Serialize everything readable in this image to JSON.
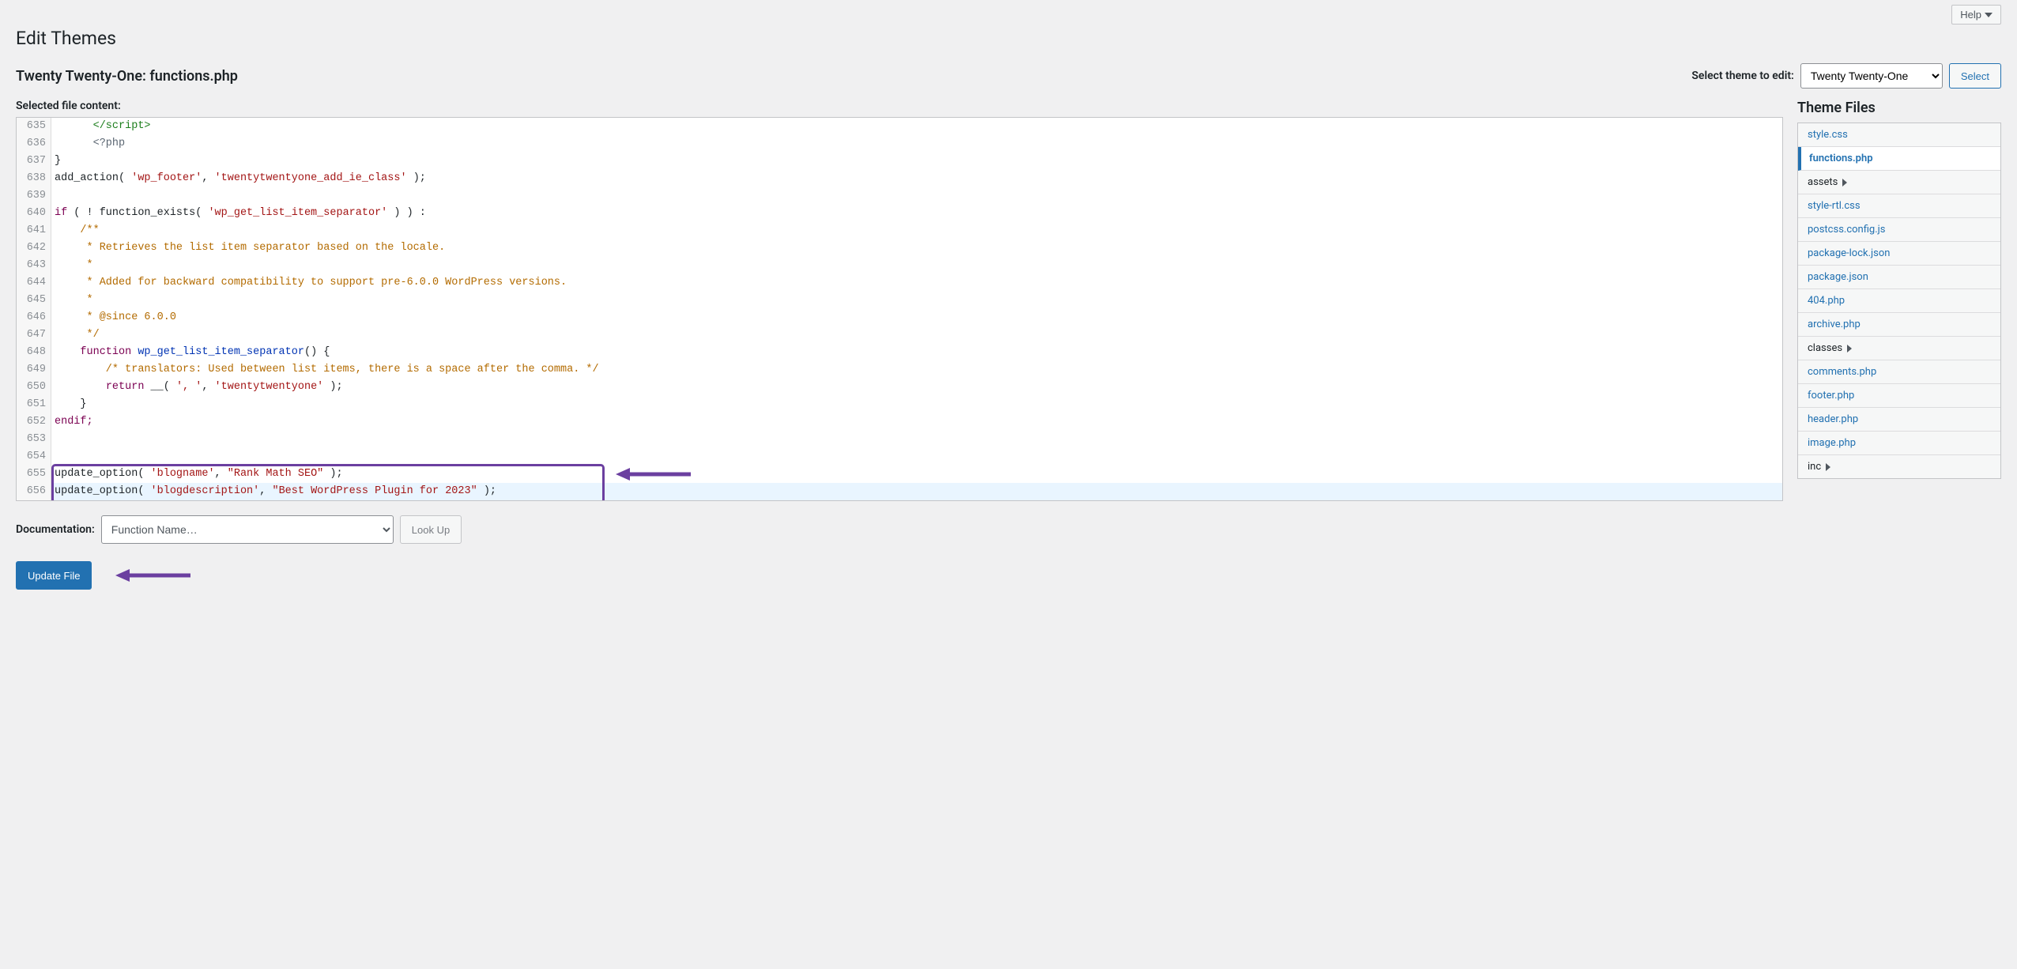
{
  "header": {
    "help": "Help",
    "page_title": "Edit Themes",
    "file_title": "Twenty Twenty-One: functions.php",
    "select_theme_label": "Select theme to edit:",
    "selected_theme": "Twenty Twenty-One",
    "select_button": "Select"
  },
  "editor": {
    "selected_file_label": "Selected file content:",
    "lines": [
      {
        "n": 635,
        "raw": "      </script>",
        "cls": "tag"
      },
      {
        "n": 636,
        "raw": "      <?php",
        "cls": "phpopen"
      },
      {
        "n": 637,
        "raw": "}",
        "cls": ""
      },
      {
        "n": 638,
        "raw": "add_action( 'wp_footer', 'twentytwentyone_add_ie_class' );",
        "cls": "call"
      },
      {
        "n": 639,
        "raw": "",
        "cls": ""
      },
      {
        "n": 640,
        "raw": "if ( ! function_exists( 'wp_get_list_item_separator' ) ) :",
        "cls": "if"
      },
      {
        "n": 641,
        "raw": "    /**",
        "cls": "cm"
      },
      {
        "n": 642,
        "raw": "     * Retrieves the list item separator based on the locale.",
        "cls": "cm"
      },
      {
        "n": 643,
        "raw": "     *",
        "cls": "cm"
      },
      {
        "n": 644,
        "raw": "     * Added for backward compatibility to support pre-6.0.0 WordPress versions.",
        "cls": "cm"
      },
      {
        "n": 645,
        "raw": "     *",
        "cls": "cm"
      },
      {
        "n": 646,
        "raw": "     * @since 6.0.0",
        "cls": "cm"
      },
      {
        "n": 647,
        "raw": "     */",
        "cls": "cm"
      },
      {
        "n": 648,
        "raw": "    function wp_get_list_item_separator() {",
        "cls": "func"
      },
      {
        "n": 649,
        "raw": "        /* translators: Used between list items, there is a space after the comma. */",
        "cls": "cm"
      },
      {
        "n": 650,
        "raw": "        return __( ', ', 'twentytwentyone' );",
        "cls": "ret"
      },
      {
        "n": 651,
        "raw": "    }",
        "cls": ""
      },
      {
        "n": 652,
        "raw": "endif;",
        "cls": "kw"
      },
      {
        "n": 653,
        "raw": "",
        "cls": ""
      },
      {
        "n": 654,
        "raw": "",
        "cls": ""
      },
      {
        "n": 655,
        "raw": "update_option( 'blogname', \"Rank Math SEO\" );",
        "cls": "call"
      },
      {
        "n": 656,
        "raw": "update_option( 'blogdescription', \"Best WordPress Plugin for 2023\" );",
        "cls": "call",
        "current": true
      }
    ]
  },
  "doc": {
    "label": "Documentation:",
    "placeholder": "Function Name…",
    "lookup": "Look Up"
  },
  "update_button": "Update File",
  "sidebar": {
    "title": "Theme Files",
    "items": [
      {
        "label": "style.css",
        "type": "link"
      },
      {
        "label": "functions.php",
        "type": "link",
        "active": true
      },
      {
        "label": "assets",
        "type": "folder"
      },
      {
        "label": "style-rtl.css",
        "type": "link"
      },
      {
        "label": "postcss.config.js",
        "type": "link"
      },
      {
        "label": "package-lock.json",
        "type": "link"
      },
      {
        "label": "package.json",
        "type": "link"
      },
      {
        "label": "404.php",
        "type": "link"
      },
      {
        "label": "archive.php",
        "type": "link"
      },
      {
        "label": "classes",
        "type": "folder"
      },
      {
        "label": "comments.php",
        "type": "link"
      },
      {
        "label": "footer.php",
        "type": "link"
      },
      {
        "label": "header.php",
        "type": "link"
      },
      {
        "label": "image.php",
        "type": "link"
      },
      {
        "label": "inc",
        "type": "folder"
      }
    ]
  }
}
